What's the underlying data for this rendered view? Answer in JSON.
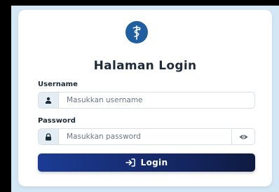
{
  "title": "Halaman Login",
  "username": {
    "label": "Username",
    "placeholder": "Masukkan username",
    "icon": "user-icon"
  },
  "password": {
    "label": "Password",
    "placeholder": "Masukkan password",
    "icon": "lock-icon",
    "toggle_icon": "eye-icon"
  },
  "login": {
    "label": "Login",
    "icon": "login-arrow-icon"
  },
  "logo": {
    "icon": "caduceus-icon"
  },
  "colors": {
    "accent": "#1f5fa0",
    "button_start": "#1b3b94",
    "button_end": "#0e1a3f",
    "background": "#d3e7f5"
  }
}
